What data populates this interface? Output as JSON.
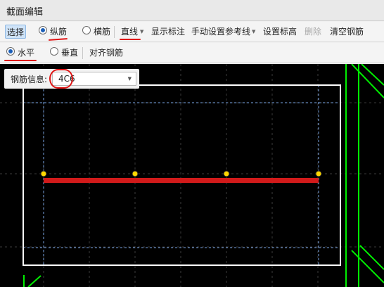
{
  "window": {
    "title": "截面编辑"
  },
  "toolbar1": {
    "select_label": "选择",
    "longitudinal_label": "纵筋",
    "transverse_label": "横筋",
    "line_mode_label": "直线",
    "show_dims_label": "显示标注",
    "manual_ref_label": "手动设置参考线",
    "set_elevation_label": "设置标高",
    "delete_label": "删除",
    "clear_rebar_label": "清空钢筋"
  },
  "toolbar2": {
    "horizontal_label": "水平",
    "vertical_label": "垂直",
    "align_rebar_label": "对齐钢筋"
  },
  "rebar_info": {
    "label": "钢筋信息:",
    "value": "4C6"
  },
  "selection": {
    "rebar_type": "longitudinal",
    "direction": "horizontal"
  },
  "colors": {
    "section_outline": "#ffffff",
    "rebar_bar": "#d11a1a",
    "rebar_point": "#ffd700",
    "guide_line": "#00ee00",
    "reference_dash": "#7aa6e6",
    "annotation": "#e01515"
  },
  "rebar_points_count": 4
}
